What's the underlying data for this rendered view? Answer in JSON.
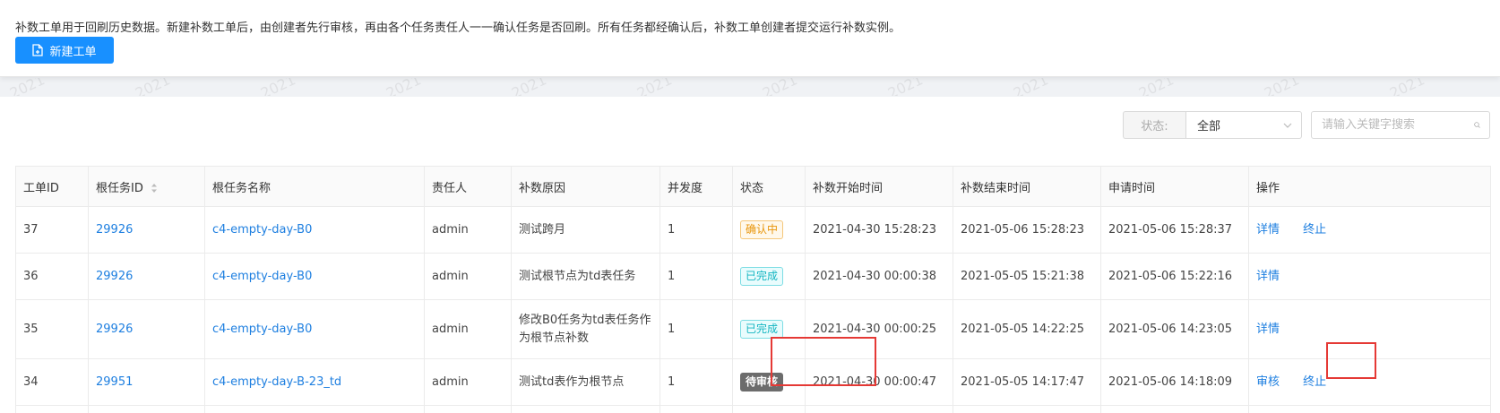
{
  "notice": {
    "text": "补数工单用于回刷历史数据。新建补数工单后，由创建者先行审核，再由各个任务责任人一一确认任务是否回刷。所有任务都经确认后，补数工单创建者提交运行补数实例。",
    "new_button_label": "新建工单",
    "new_button_icon": "file-add-icon"
  },
  "watermark": "2021",
  "filters": {
    "status_label": "状态:",
    "status_value": "全部",
    "search_placeholder": "请输入关键字搜索"
  },
  "table": {
    "columns": [
      "工单ID",
      "根任务ID",
      "根任务名称",
      "责任人",
      "补数原因",
      "并发度",
      "状态",
      "补数开始时间",
      "补数结束时间",
      "申请时间",
      "操作"
    ],
    "rows": [
      {
        "id": "37",
        "root_id": "29926",
        "root_name": "c4-empty-day-B0",
        "owner": "admin",
        "reason": "测试跨月",
        "concurrency": "1",
        "status": "确认中",
        "start": "2021-04-30 15:28:23",
        "end": "2021-05-06 15:28:23",
        "applied": "2021-05-06 15:28:37",
        "actions": [
          "详情",
          "终止"
        ]
      },
      {
        "id": "36",
        "root_id": "29926",
        "root_name": "c4-empty-day-B0",
        "owner": "admin",
        "reason": "测试根节点为td表任务",
        "concurrency": "1",
        "status": "已完成",
        "start": "2021-04-30 00:00:38",
        "end": "2021-05-05 15:21:38",
        "applied": "2021-05-06 15:22:16",
        "actions": [
          "详情"
        ]
      },
      {
        "id": "35",
        "root_id": "29926",
        "root_name": "c4-empty-day-B0",
        "owner": "admin",
        "reason": "修改B0任务为td表任务作为根节点补数",
        "concurrency": "1",
        "status": "已完成",
        "start": "2021-04-30 00:00:25",
        "end": "2021-05-05 14:22:25",
        "applied": "2021-05-06 14:23:05",
        "actions": [
          "详情"
        ]
      },
      {
        "id": "34",
        "root_id": "29951",
        "root_name": "c4-empty-day-B-23_td",
        "owner": "admin",
        "reason": "测试td表作为根节点",
        "concurrency": "1",
        "status": "待审核",
        "start": "2021-04-30 00:00:47",
        "end": "2021-05-05 14:17:47",
        "applied": "2021-05-06 14:18:09",
        "actions": [
          "审核",
          "终止"
        ]
      }
    ]
  },
  "colors": {
    "primary": "#1890ff",
    "link": "#1e7fe0",
    "highlight": "#e53935",
    "status_confirming": "#e8950b",
    "status_done": "#13b5c1",
    "status_pending": "#6c6c6c"
  }
}
